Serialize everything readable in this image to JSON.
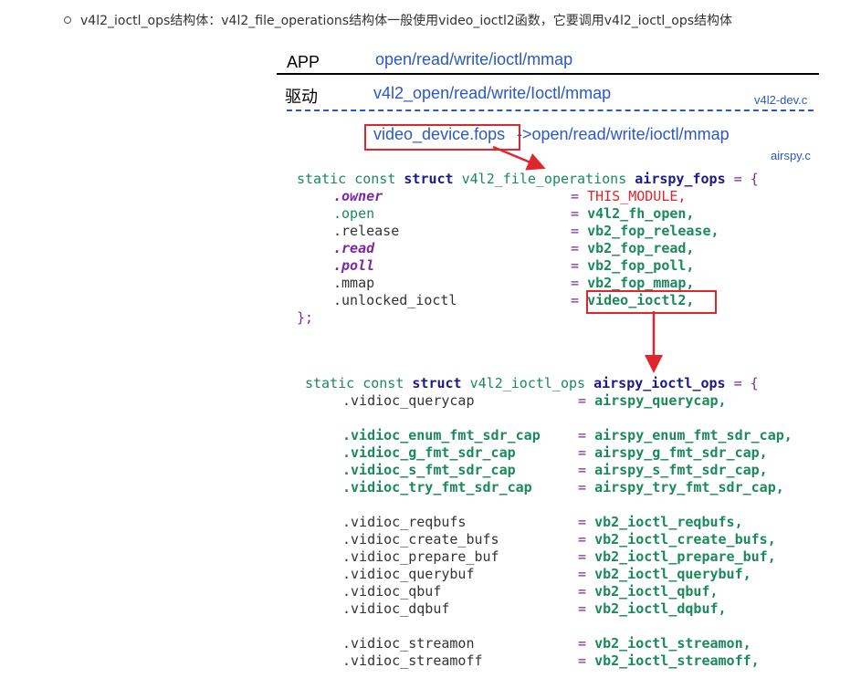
{
  "bullet": {
    "text": "v4l2_ioctl_ops结构体：v4l2_file_operations结构体一般使用video_ioctl2函数，它要调用v4l2_ioctl_ops结构体"
  },
  "diagram": {
    "app_label": "APP",
    "app_calls": "open/read/write/ioctl/mmap",
    "driver_label": "驱动",
    "driver_calls": "v4l2_open/read/write/Ioctl/mmap",
    "v4l2_dev_file": "v4l2-dev.c",
    "video_device_fops": "video_device.fops",
    "fops_calls": "->open/read/write/ioctl/mmap",
    "airspy_file": "airspy.c"
  },
  "fops_struct": {
    "kw": "static const ",
    "struct_kw": "struct",
    "type": " v4l2_file_operations ",
    "name": "airspy_fops",
    "open": " = {",
    "close": "};",
    "fields": [
      {
        "name": ".owner",
        "value": "THIS_MODULE,"
      },
      {
        "name": ".open",
        "value": "v4l2_fh_open,"
      },
      {
        "name": ".release",
        "value": "vb2_fop_release,"
      },
      {
        "name": ".read",
        "value": "vb2_fop_read,"
      },
      {
        "name": ".poll",
        "value": "vb2_fop_poll,"
      },
      {
        "name": ".mmap",
        "value": "vb2_fop_mmap,"
      },
      {
        "name": ".unlocked_ioctl",
        "value": "video_ioctl2,"
      }
    ]
  },
  "ioctl_struct": {
    "kw": "static const ",
    "struct_kw": "struct",
    "type": " v4l2_ioctl_ops ",
    "name": "airspy_ioctl_ops",
    "open": " = {",
    "fields": [
      {
        "name": ".vidioc_querycap",
        "value": "airspy_querycap,"
      },
      {
        "name": ".vidioc_enum_fmt_sdr_cap",
        "value": "airspy_enum_fmt_sdr_cap,"
      },
      {
        "name": ".vidioc_g_fmt_sdr_cap",
        "value": "airspy_g_fmt_sdr_cap,"
      },
      {
        "name": ".vidioc_s_fmt_sdr_cap",
        "value": "airspy_s_fmt_sdr_cap,"
      },
      {
        "name": ".vidioc_try_fmt_sdr_cap",
        "value": "airspy_try_fmt_sdr_cap,"
      },
      {
        "name": ".vidioc_reqbufs",
        "value": "vb2_ioctl_reqbufs,"
      },
      {
        "name": ".vidioc_create_bufs",
        "value": "vb2_ioctl_create_bufs,"
      },
      {
        "name": ".vidioc_prepare_buf",
        "value": "vb2_ioctl_prepare_buf,"
      },
      {
        "name": ".vidioc_querybuf",
        "value": "vb2_ioctl_querybuf,"
      },
      {
        "name": ".vidioc_qbuf",
        "value": "vb2_ioctl_qbuf,"
      },
      {
        "name": ".vidioc_dqbuf",
        "value": "vb2_ioctl_dqbuf,"
      },
      {
        "name": ".vidioc_streamon",
        "value": "vb2_ioctl_streamon,"
      },
      {
        "name": ".vidioc_streamoff",
        "value": "vb2_ioctl_streamoff,"
      }
    ]
  },
  "colors": {
    "accent_blue": "#2b57c8",
    "highlight_red": "#e0262d",
    "code_green": "#1a8a5a",
    "code_navy": "#1a1a8a",
    "code_purple": "#7a2aa0"
  }
}
